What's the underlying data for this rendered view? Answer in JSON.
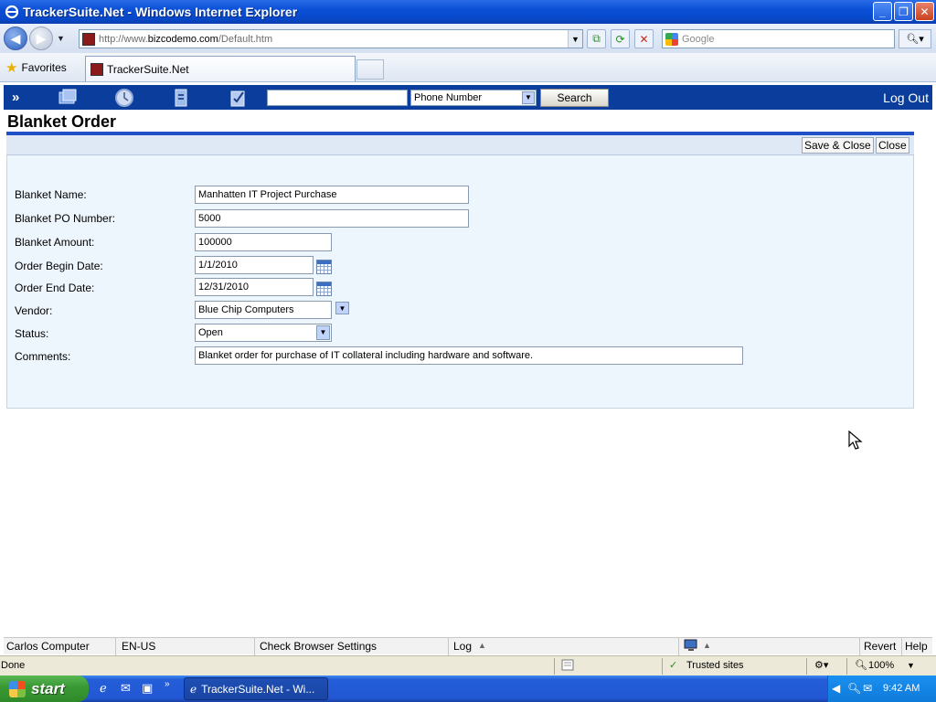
{
  "window": {
    "title": "TrackerSuite.Net - Windows Internet Explorer",
    "minimize": "_",
    "maximize": "❐",
    "close": "✕"
  },
  "browser": {
    "url": {
      "prefix": "http://www.",
      "domain": "bizcodemo.com",
      "path": "/Default.htm"
    },
    "search_placeholder": "Google",
    "favorites_label": "Favorites",
    "tab_title": "TrackerSuite.Net"
  },
  "toolbar": {
    "expand_icon": "»",
    "search_value": "",
    "search_field_selected": "Phone Number",
    "search_button": "Search",
    "logout": "Log Out"
  },
  "page": {
    "title": "Blanket Order",
    "save_close": "Save & Close",
    "close": "Close"
  },
  "form": {
    "fields": [
      {
        "label": "Blanket Name:",
        "value": "Manhatten IT Project Purchase"
      },
      {
        "label": "Blanket PO Number:",
        "value": "5000"
      },
      {
        "label": "Blanket Amount:",
        "value": "100000"
      },
      {
        "label": "Order Begin Date:",
        "value": "1/1/2010"
      },
      {
        "label": "Order End Date:",
        "value": "12/31/2010"
      },
      {
        "label": "Vendor:",
        "value": "Blue Chip Computers"
      },
      {
        "label": "Status:",
        "value": "Open"
      },
      {
        "label": "Comments:",
        "value": "Blanket order for purchase of IT collateral including hardware and software."
      }
    ]
  },
  "app_footer": {
    "user": "Carlos Computer",
    "locale": "EN-US",
    "check_settings": "Check Browser Settings",
    "log": "Log",
    "revert": "Revert",
    "help": "Help"
  },
  "statusbar": {
    "status": "Done",
    "zone": "Trusted sites",
    "zoom": "100%"
  },
  "taskbar": {
    "start": "start",
    "task": "TrackerSuite.Net - Wi...",
    "clock": "9:42 AM"
  }
}
